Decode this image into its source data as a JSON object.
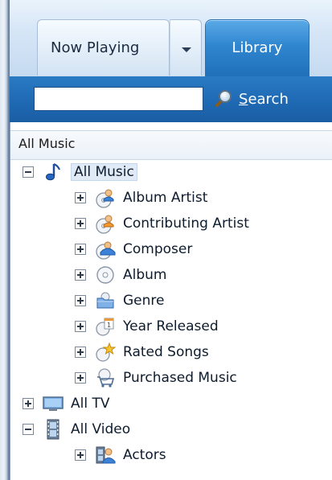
{
  "tabs": {
    "now_playing": "Now Playing",
    "library": "Library"
  },
  "search": {
    "placeholder": "",
    "button_label_first": "S",
    "button_label_rest": "earch"
  },
  "header": {
    "title": "All Music"
  },
  "tree": {
    "all_music": "All Music",
    "music_children": [
      {
        "label": "Album Artist",
        "icon": "album-artist-icon"
      },
      {
        "label": "Contributing Artist",
        "icon": "contributing-artist-icon"
      },
      {
        "label": "Composer",
        "icon": "composer-icon"
      },
      {
        "label": "Album",
        "icon": "album-disc-icon"
      },
      {
        "label": "Genre",
        "icon": "genre-folder-icon"
      },
      {
        "label": "Year Released",
        "icon": "year-calendar-icon"
      },
      {
        "label": "Rated Songs",
        "icon": "rated-star-icon"
      },
      {
        "label": "Purchased Music",
        "icon": "purchased-cart-icon"
      }
    ],
    "all_tv": "All TV",
    "all_video": "All Video",
    "video_children": [
      {
        "label": "Actors",
        "icon": "actors-icon"
      }
    ]
  },
  "colors": {
    "library_tab": "#2f86cf",
    "search_strip": "#1e68b2",
    "selection": "#dfeaf6"
  }
}
